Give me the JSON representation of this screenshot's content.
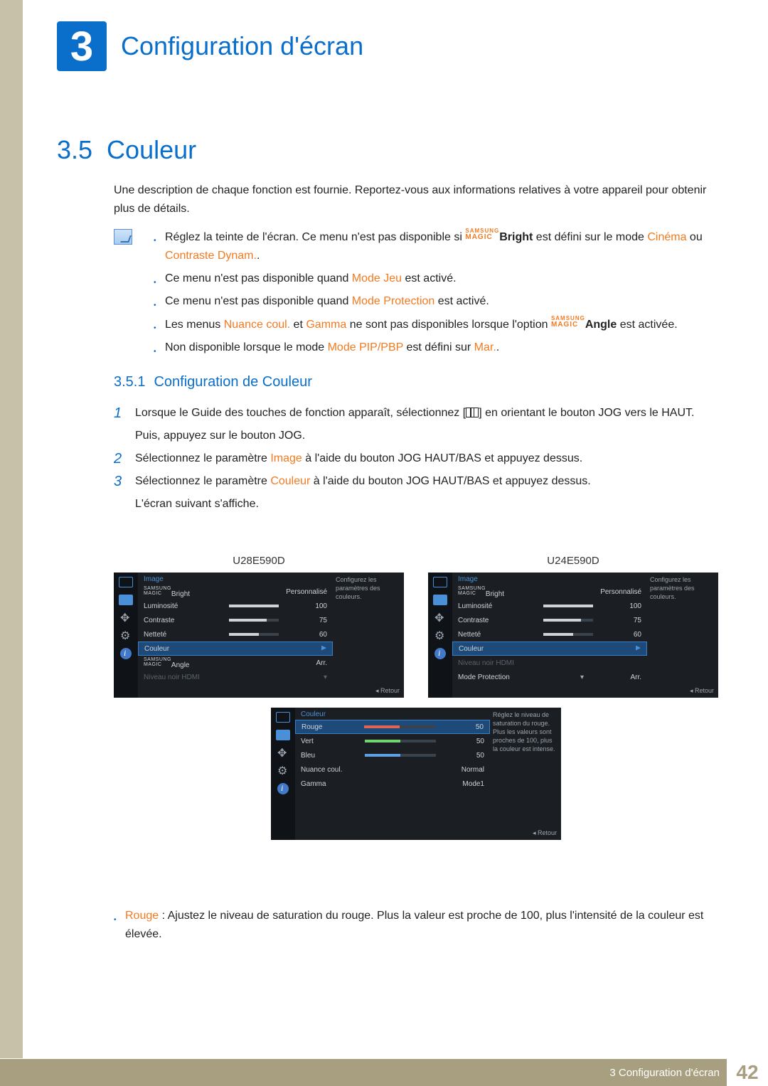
{
  "chapter": {
    "number": "3",
    "title": "Configuration d'écran"
  },
  "section": {
    "number": "3.5",
    "title": "Couleur"
  },
  "intro": "Une description de chaque fonction est fournie. Reportez-vous aux informations relatives à votre appareil pour obtenir plus de détails.",
  "notes": {
    "n1_a": "Réglez la teinte de l'écran. Ce menu n'est pas disponible si ",
    "n1_magic_upper": "SAMSUNG",
    "n1_magic_lower": "MAGIC",
    "n1_bright": "Bright",
    "n1_b": " est défini sur le mode ",
    "n1_cinema": "Cinéma",
    "n1_or": " ou ",
    "n1_contrast": "Contraste Dynam.",
    "n1_dot": ".",
    "n2_a": "Ce menu n'est pas disponible quand ",
    "n2_mode": "Mode Jeu",
    "n2_b": " est activé.",
    "n3_a": "Ce menu n'est pas disponible quand ",
    "n3_mode": "Mode Protection",
    "n3_b": " est activé.",
    "n4_a": "Les menus ",
    "n4_nuance": "Nuance coul.",
    "n4_and": " et ",
    "n4_gamma": "Gamma",
    "n4_b": " ne sont pas disponibles lorsque l'option ",
    "n4_magic_upper": "SAMSUNG",
    "n4_magic_lower": "MAGIC",
    "n4_angle": "Angle",
    "n4_c": " est activée.",
    "n5_a": "Non disponible lorsque le mode ",
    "n5_mode": "Mode PIP/PBP",
    "n5_b": " est défini sur ",
    "n5_mar": "Mar.",
    "n5_dot": "."
  },
  "subsection": {
    "number": "3.5.1",
    "title": "Configuration de Couleur"
  },
  "steps": {
    "s1_a": "Lorsque le Guide des touches de fonction apparaît, sélectionnez [",
    "s1_b": "] en orientant le bouton JOG vers le HAUT.",
    "s1_c": "Puis, appuyez sur le bouton JOG.",
    "s2_a": "Sélectionnez le paramètre ",
    "s2_img": "Image",
    "s2_b": " à l'aide du bouton JOG HAUT/BAS et appuyez dessus.",
    "s3_a": "Sélectionnez le paramètre ",
    "s3_col": "Couleur",
    "s3_b": " à l'aide du bouton JOG HAUT/BAS et appuyez dessus.",
    "s3_c": "L'écran suivant s'affiche."
  },
  "models": {
    "left": "U28E590D",
    "right": "U24E590D"
  },
  "osd_a": {
    "header": "Image",
    "desc": "Configurez les paramètres des couleurs.",
    "items": [
      {
        "label_pre": "SAMSUNG",
        "label_mid": "MAGIC",
        "label_suf": "Bright",
        "value": "Personnalisé",
        "bar": null
      },
      {
        "label": "Luminosité",
        "value": "100",
        "bar": 100
      },
      {
        "label": "Contraste",
        "value": "75",
        "bar": 75
      },
      {
        "label": "Netteté",
        "value": "60",
        "bar": 60
      },
      {
        "label": "Couleur",
        "value": "",
        "highlight": true,
        "arrow": true
      },
      {
        "label_pre": "SAMSUNG",
        "label_mid": "MAGIC",
        "label_suf": "Angle",
        "value": "Arr."
      },
      {
        "label": "Niveau noir HDMI",
        "value": "",
        "dim": true,
        "down": true
      }
    ],
    "footer": "Retour"
  },
  "osd_b": {
    "header": "Image",
    "desc": "Configurez les paramètres des couleurs.",
    "items": [
      {
        "label_pre": "SAMSUNG",
        "label_mid": "MAGIC",
        "label_suf": "Bright",
        "value": "Personnalisé",
        "bar": null
      },
      {
        "label": "Luminosité",
        "value": "100",
        "bar": 100
      },
      {
        "label": "Contraste",
        "value": "75",
        "bar": 75
      },
      {
        "label": "Netteté",
        "value": "60",
        "bar": 60
      },
      {
        "label": "Couleur",
        "value": "",
        "highlight": true,
        "arrow": true
      },
      {
        "label": "Niveau noir HDMI",
        "value": "",
        "dim": true
      },
      {
        "label": "Mode Protection",
        "value": "Arr.",
        "down": true
      }
    ],
    "footer": "Retour"
  },
  "osd_c": {
    "header": "Couleur",
    "desc": "Réglez le niveau de saturation du rouge. Plus les valeurs sont proches de 100, plus la couleur est intense.",
    "items": [
      {
        "label": "Rouge",
        "value": "50",
        "bar": 50,
        "color": "#e06555",
        "highlight": true
      },
      {
        "label": "Vert",
        "value": "50",
        "bar": 50,
        "color": "#6fd66f"
      },
      {
        "label": "Bleu",
        "value": "50",
        "bar": 50,
        "color": "#5ea0e8"
      },
      {
        "label": "Nuance coul.",
        "value": "Normal"
      },
      {
        "label": "Gamma",
        "value": "Mode1"
      }
    ],
    "footer": "Retour"
  },
  "post": {
    "a": "Rouge",
    "b": " : Ajustez le niveau de saturation du rouge. Plus la valeur est proche de 100, plus l'intensité de la couleur est élevée."
  },
  "footer": {
    "text": "3 Configuration d'écran",
    "page": "42"
  }
}
